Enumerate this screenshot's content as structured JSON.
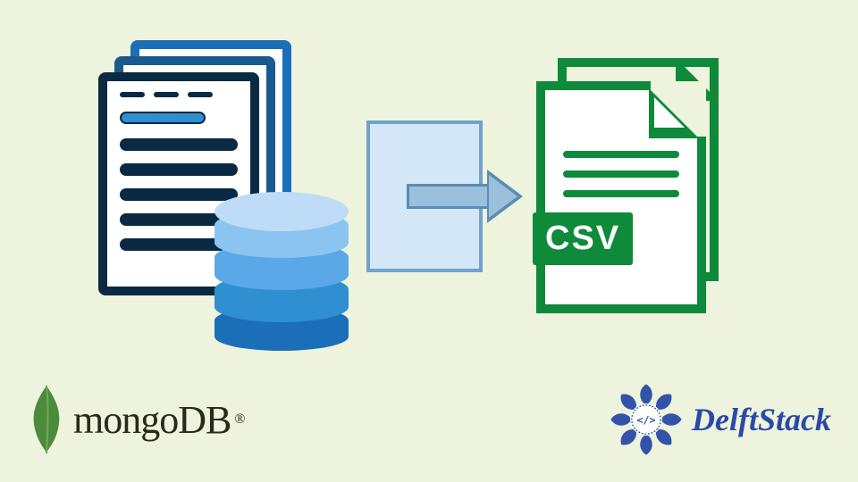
{
  "diagram": {
    "source": {
      "type": "document-database",
      "layers": 3,
      "db_bands": 4
    },
    "action": "export",
    "target": {
      "type": "csv-file",
      "badge_label": "CSV"
    }
  },
  "logos": {
    "mongodb": {
      "text": "mongoDB",
      "registered": "®"
    },
    "delftstack": {
      "text": "DelftStack"
    }
  },
  "colors": {
    "bg": "#edf3dc",
    "doc_dark": "#0a2a43",
    "doc_blue": "#1b6fb8",
    "db_shades": [
      "#bedcf7",
      "#8cc4f1",
      "#5aa8e8",
      "#2f8fd1",
      "#1b6fb8"
    ],
    "arrow_fill": "#9bc0dc",
    "arrow_border": "#5a8db5",
    "csv_green": "#0e8a3a",
    "mongo_leaf": "#4b8b3b",
    "delft_blue": "#2a4aa8"
  }
}
